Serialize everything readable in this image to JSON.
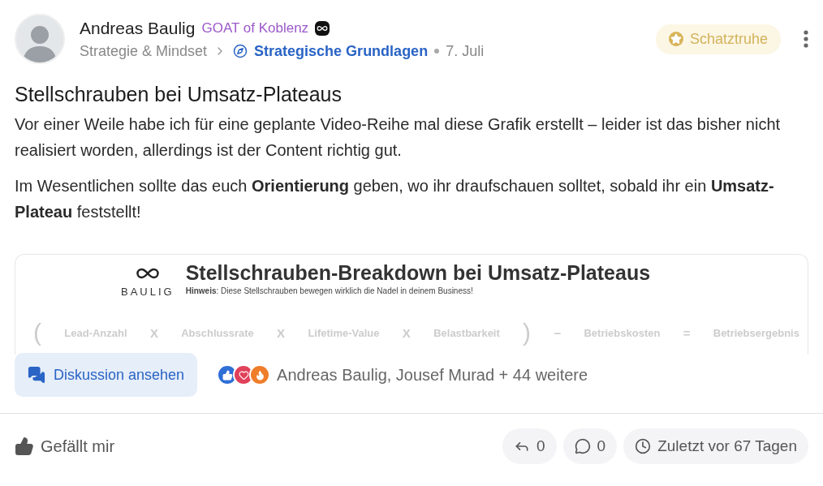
{
  "author": {
    "name": "Andreas Baulig",
    "title": "GOAT of Koblenz"
  },
  "breadcrumb": {
    "category": "Strategie & Mindset",
    "subcategory": "Strategische Grundlagen",
    "date": "7. Juli"
  },
  "badge": {
    "label": "Schatztruhe"
  },
  "post": {
    "title": "Stellschrauben bei Umsatz-Plateaus",
    "paragraphs": [
      "Vor einer Weile habe ich für eine geplante Video-Reihe mal diese Grafik erstellt – leider ist das bisher nicht realisiert worden, allerdings ist der Content richtig gut.",
      "Im Wesentlichen sollte das euch **Orientierung** geben, wo ihr draufschauen solltet, sobald ihr ein **Umsatz-Plateau** feststellt!"
    ]
  },
  "graphic": {
    "logo_text": "BAULIG",
    "title": "Stellschrauben-Breakdown bei Umsatz-Plateaus",
    "hint": "**Hinweis**: Diese Stellschrauben bewegen wirklich die Nadel in deinem Business!",
    "formula": [
      {
        "kind": "bracket",
        "text": "("
      },
      {
        "kind": "term",
        "text": "Lead-Anzahl"
      },
      {
        "kind": "operator",
        "text": "X"
      },
      {
        "kind": "term",
        "text": "Abschlussrate"
      },
      {
        "kind": "operator",
        "text": "X"
      },
      {
        "kind": "term",
        "text": "Lifetime-Value"
      },
      {
        "kind": "operator",
        "text": "X"
      },
      {
        "kind": "term",
        "text": "Belastbarkeit"
      },
      {
        "kind": "bracket",
        "text": ")"
      },
      {
        "kind": "operator",
        "text": "−"
      },
      {
        "kind": "term",
        "text": "Betriebskosten"
      },
      {
        "kind": "operator",
        "text": "="
      },
      {
        "kind": "term",
        "text": "Betriebsergebnis"
      }
    ]
  },
  "discussion_button": "Diskussion ansehen",
  "reactions": {
    "text": "Andreas Baulig, Jousef Murad + 44 weitere"
  },
  "footer": {
    "like": "Gefällt mir",
    "replies": "0",
    "comments": "0",
    "last_activity": "Zuletzt vor 67 Tagen"
  }
}
